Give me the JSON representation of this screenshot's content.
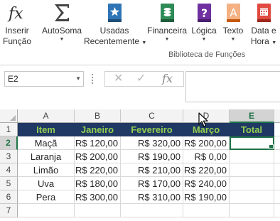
{
  "ribbon": {
    "buttons": [
      {
        "id": "inserir",
        "line1": "Inserir",
        "line2": "Função",
        "icon": "fx-icon",
        "dropdown": false
      },
      {
        "id": "autosoma",
        "line1": "AutoSoma",
        "line2": "",
        "icon": "sigma-icon",
        "dropdown": true
      },
      {
        "id": "usadas",
        "line1": "Usadas",
        "line2": "Recentemente",
        "icon": "star-book-icon",
        "dropdown": true
      },
      {
        "id": "financeira",
        "line1": "Financeira",
        "line2": "",
        "icon": "financial-book-icon",
        "dropdown": true
      },
      {
        "id": "logica",
        "line1": "Lógica",
        "line2": "",
        "icon": "question-book-icon",
        "dropdown": true
      },
      {
        "id": "texto",
        "line1": "Texto",
        "line2": "",
        "icon": "text-book-icon",
        "dropdown": true
      },
      {
        "id": "data",
        "line1": "Data e",
        "line2": "Hora",
        "icon": "calendar-book-icon",
        "dropdown": true
      }
    ],
    "group_label": "Biblioteca de Funções"
  },
  "formula_bar": {
    "name_box": "E2",
    "cancel_symbol": "✕",
    "enter_symbol": "✓",
    "fx_symbol": "fx",
    "formula": ""
  },
  "sheet": {
    "columns": [
      "A",
      "B",
      "C",
      "D",
      "E"
    ],
    "selected_column": "E",
    "rows": [
      "1",
      "2",
      "3",
      "4",
      "5",
      "6",
      "7"
    ],
    "selected_row": "2",
    "header": [
      "Item",
      "Janeiro",
      "Fevereiro",
      "Março",
      "Total"
    ],
    "data": [
      [
        "Maçã",
        "R$ 120,00",
        "R$ 320,00",
        "R$ 200,00",
        ""
      ],
      [
        "Laranja",
        "R$ 200,00",
        "R$ 190,00",
        "R$ 0,00",
        ""
      ],
      [
        "Limão",
        "R$ 220,00",
        "R$ 210,00",
        "R$ 220,00",
        ""
      ],
      [
        "Uva",
        "R$ 180,00",
        "R$ 170,00",
        "R$ 240,00",
        ""
      ],
      [
        "Pera",
        "R$ 300,00",
        "R$ 310,00",
        "R$ 190,00",
        ""
      ]
    ]
  },
  "colors": {
    "header_fill": "#1f3864",
    "header_text": "#92d050",
    "selection": "#217346"
  }
}
